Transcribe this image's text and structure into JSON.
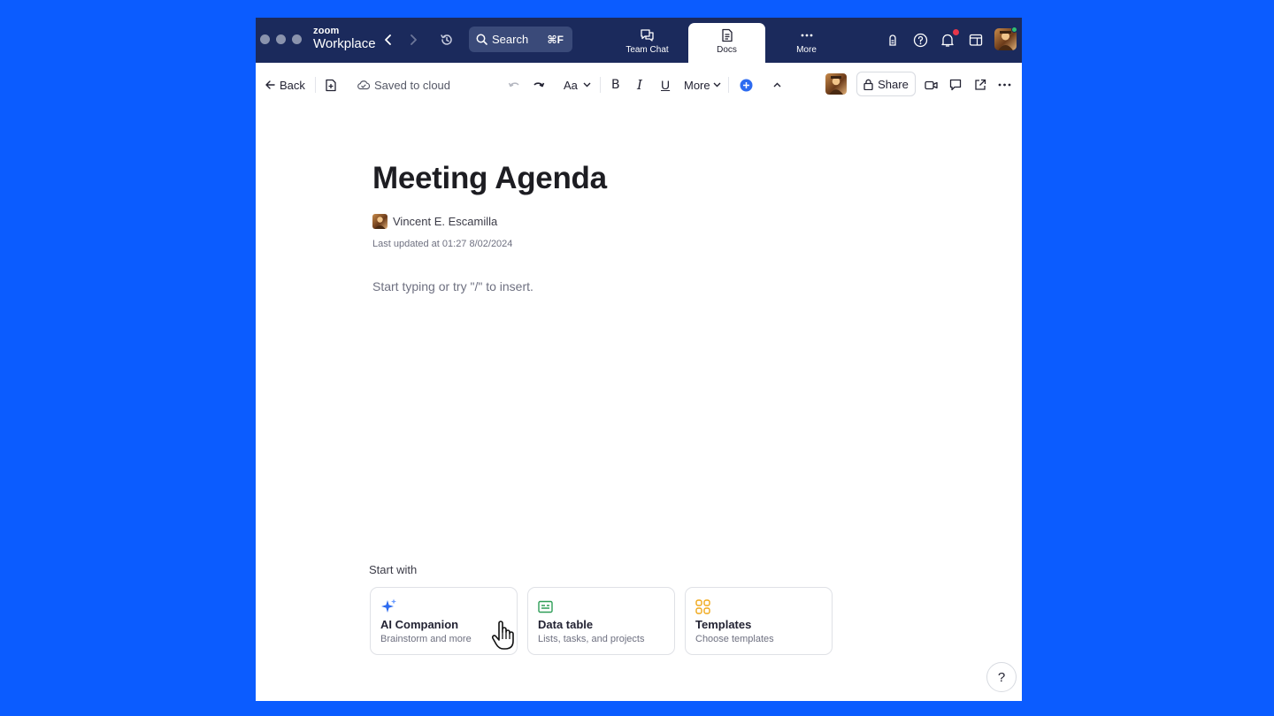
{
  "app": {
    "brand_small": "zoom",
    "brand_large": "Workplace",
    "search_label": "Search",
    "search_shortcut": "⌘F",
    "tabs": [
      {
        "label": "Team Chat",
        "icon": "chat-icon",
        "active": false
      },
      {
        "label": "Docs",
        "icon": "docs-icon",
        "active": true
      },
      {
        "label": "More",
        "icon": "more-icon",
        "active": false
      }
    ],
    "notification_dot_color": "#e8364a",
    "online_status_color": "#2fbf71"
  },
  "toolbar": {
    "back_label": "Back",
    "saved_status": "Saved to cloud",
    "text_style_label": "Aa",
    "bold_label": "B",
    "italic_label": "I",
    "underline_label": "U",
    "more_label": "More",
    "share_label": "Share"
  },
  "document": {
    "title": "Meeting Agenda",
    "author": "Vincent E. Escamilla",
    "last_updated": "Last updated at 01:27 8/02/2024",
    "placeholder": "Start typing or try \"/\" to insert."
  },
  "start_with": {
    "heading": "Start with",
    "cards": [
      {
        "title": "AI Companion",
        "subtitle": "Brainstorm and more",
        "icon": "sparkle-icon",
        "icon_color": "#2d6bf0"
      },
      {
        "title": "Data table",
        "subtitle": "Lists, tasks, and projects",
        "icon": "table-icon",
        "icon_color": "#2e9e57"
      },
      {
        "title": "Templates",
        "subtitle": "Choose templates",
        "icon": "templates-icon",
        "icon_color": "#f0a81a"
      }
    ]
  },
  "help_label": "?",
  "colors": {
    "background": "#0B5CFF",
    "titlebar": "#1b2a5c",
    "accent": "#2d6bf0"
  }
}
